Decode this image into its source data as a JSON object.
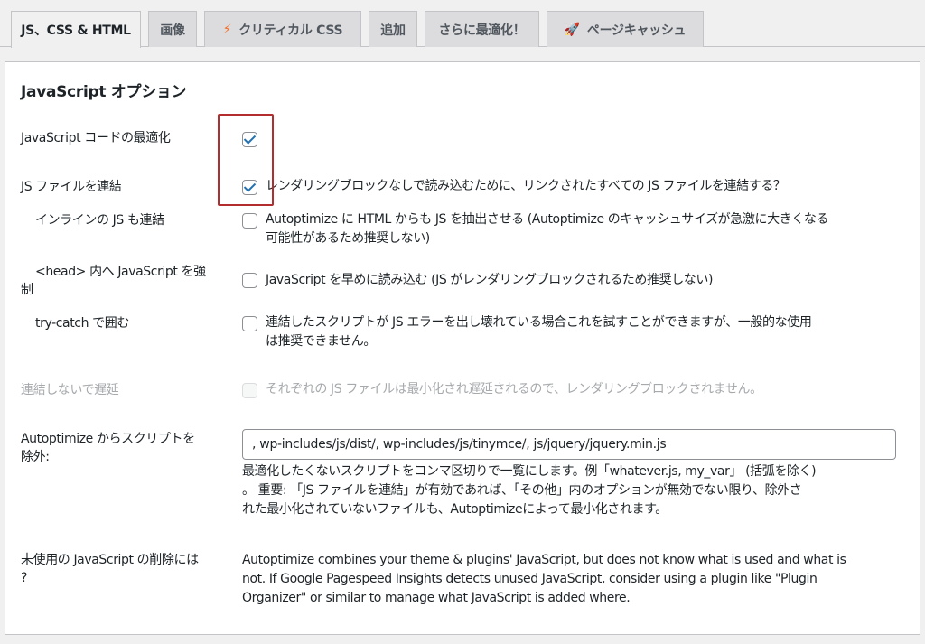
{
  "tabs": [
    {
      "label": "JS、CSS & HTML",
      "icon": ""
    },
    {
      "label": "画像",
      "icon": ""
    },
    {
      "label": "クリティカル CSS",
      "icon": "bolt-icon"
    },
    {
      "label": "追加",
      "icon": ""
    },
    {
      "label": "さらに最適化！",
      "icon": ""
    },
    {
      "label": "ページキャッシュ",
      "icon": "rocket-icon"
    }
  ],
  "section": {
    "title": "JavaScript オプション"
  },
  "options": {
    "optimize_code": {
      "label": "JavaScript コードの最適化",
      "checked": true
    },
    "aggregate": {
      "label": "JS ファイルを連結",
      "checked": true,
      "desc": "レンダリングブロックなしで読み込むために、リンクされたすべての JS ファイルを連結する？"
    },
    "inline": {
      "label": "インラインの JS も連結",
      "checked": false,
      "desc_line1": "Autoptimize に HTML からも JS を抽出させる (Autoptimize のキャッシュサイズが急激に大きくなる",
      "desc_line2": "可能性があるため推奨しない)"
    },
    "force_head": {
      "label_line1": "<head> 内へ JavaScript を強",
      "label_line2": "制",
      "checked": false,
      "desc": "JavaScript を早めに読み込む (JS がレンダリングブロックされるため推奨しない)"
    },
    "try_catch": {
      "label": "try-catch で囲む",
      "checked": false,
      "desc_line1": "連結したスクリプトが JS エラーを出し壊れている場合これを試すことができますが、一般的な使用",
      "desc_line2": "は推奨できません。"
    },
    "defer_not_agg": {
      "label": "連結しないで遅延",
      "checked": false,
      "disabled": true,
      "desc": "それぞれの JS ファイルは最小化され遅延されるので、レンダリングブロックされません。"
    }
  },
  "exclude": {
    "label_line1": "Autoptimize からスクリプトを",
    "label_line2": "除外:",
    "value": ", wp-includes/js/dist/, wp-includes/js/tinymce/, js/jquery/jquery.min.js",
    "help_line1": "最適化したくないスクリプトをコンマ区切りで一覧にします。例「whatever.js, my_var」 (括弧を除く)",
    "help_line2": "。 重要: 「JS ファイルを連結」が有効であれば、「その他」内のオプションが無効でない限り、除外さ",
    "help_line3": "れた最小化されていないファイルも、Autoptimizeによって最小化されます。"
  },
  "unused": {
    "label_line1": "未使用の JavaScript の削除には",
    "label_line2": "?",
    "text_line1": "Autoptimize combines your theme & plugins' JavaScript, but does not know what is used and what is",
    "text_line2": "not. If Google Pagespeed Insights detects unused JavaScript, consider using a plugin like \"Plugin",
    "text_line3": "Organizer\" or similar to manage what JavaScript is added where."
  },
  "colors": {
    "accent": "#2271b1",
    "highlight": "#b32d2e"
  }
}
